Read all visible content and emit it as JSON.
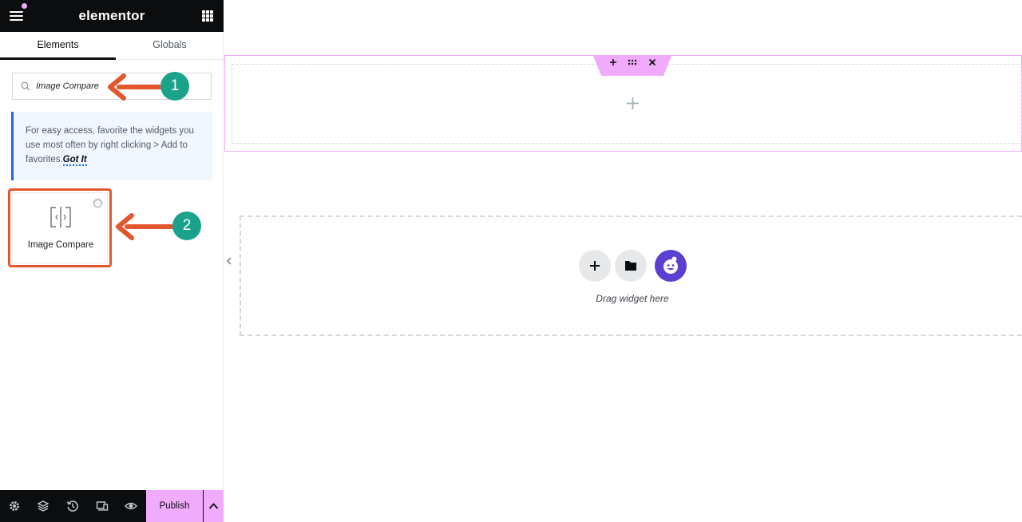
{
  "topbar": {
    "brand": "elementor",
    "menu_icon": "hamburger-menu-icon",
    "apps_icon": "grid-apps-icon"
  },
  "tabs": [
    {
      "label": "Elements",
      "active": true
    },
    {
      "label": "Globals",
      "active": false
    }
  ],
  "search": {
    "value": "Image Compare",
    "icon": "search-icon"
  },
  "notice": {
    "text": "For easy access, favorite the widgets you use most often by right clicking > Add to favorites.",
    "link": "Got It"
  },
  "widget": {
    "label": "Image Compare",
    "icon": "image-compare-icon",
    "badge_icon": "pro-badge-icon"
  },
  "annotations": {
    "step1": "1",
    "step2": "2",
    "arrow_color": "#e4572e",
    "circle_color": "#1aa38a"
  },
  "bottombar": {
    "icons": [
      "settings-gear-icon",
      "layers-icon",
      "history-icon",
      "responsive-icon",
      "preview-eye-icon"
    ],
    "publish_label": "Publish",
    "more_icon": "chevron-up-icon"
  },
  "canvas": {
    "drop_text": "Drag widget here",
    "buttons": [
      "add-plus-icon",
      "folder-icon",
      "elementskit-icon"
    ]
  },
  "colors": {
    "accent_pink": "#f0abfc",
    "dark": "#0c0d0e",
    "purple": "#5b3fd1"
  }
}
